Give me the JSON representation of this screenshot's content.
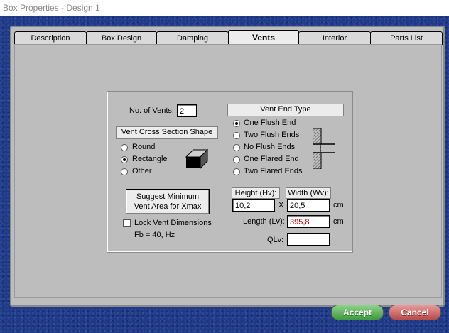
{
  "window": {
    "title": "Box Properties - Design 1"
  },
  "tabs": [
    {
      "label": "Description"
    },
    {
      "label": "Box Design"
    },
    {
      "label": "Damping"
    },
    {
      "label": "Vents",
      "active": true
    },
    {
      "label": "Interior"
    },
    {
      "label": "Parts List"
    }
  ],
  "vents": {
    "count_label": "No. of Vents:",
    "count_value": "2",
    "cross_section": {
      "header": "Vent Cross Section Shape",
      "options": [
        "Round",
        "Rectangle",
        "Other"
      ],
      "selected": "Rectangle"
    },
    "end_type": {
      "header": "Vent End Type",
      "options": [
        "One Flush End",
        "Two Flush Ends",
        "No Flush Ends",
        "One Flared End",
        "Two Flared Ends"
      ],
      "selected": "One Flush End"
    },
    "suggest_button": {
      "line1": "Suggest Minimum",
      "line2": "Vent Area for Xmax"
    },
    "lock_label": "Lock Vent Dimensions",
    "fb_text": "Fb = 40, Hz",
    "height_label": "Height (Hv):",
    "height_value": "10,2",
    "x_label": "X",
    "width_label": "Width (Wv):",
    "width_value": "20,5",
    "unit_cm": "cm",
    "length_label": "Length (Lv):",
    "length_value": "395,8",
    "length_color": "#cc0000",
    "qlv_label": "QLv:",
    "qlv_value": ""
  },
  "footer": {
    "accept": "Accept",
    "cancel": "Cancel"
  }
}
